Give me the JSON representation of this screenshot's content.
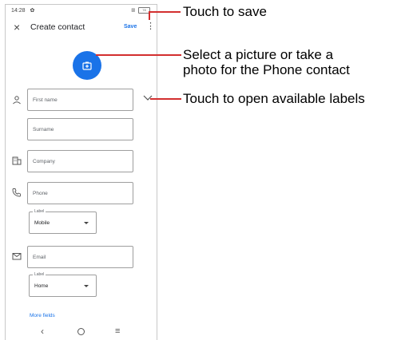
{
  "status_bar": {
    "time": "14:28",
    "battery": "78"
  },
  "header": {
    "title": "Create contact",
    "save_label": "Save"
  },
  "form": {
    "first_name_placeholder": "First name",
    "surname_placeholder": "Surname",
    "company_placeholder": "Company",
    "phone_placeholder": "Phone",
    "phone_label_caption": "Label",
    "phone_label_value": "Mobile",
    "email_placeholder": "Email",
    "email_label_caption": "Label",
    "email_label_value": "Home",
    "more_fields": "More fields"
  },
  "callouts": {
    "save": "Touch to save",
    "photo_line1": "Select a picture or take a",
    "photo_line2": "photo for the Phone contact",
    "labels": "Touch to open available labels"
  },
  "colors": {
    "accent": "#1a73e8",
    "callout": "#d32f2f"
  },
  "icons": [
    "gear-icon",
    "close-icon",
    "more-vert-icon",
    "add-photo-icon",
    "person-icon",
    "chevron-down-icon",
    "business-icon",
    "phone-icon",
    "email-icon",
    "back-icon",
    "home-icon",
    "menu-icon"
  ]
}
